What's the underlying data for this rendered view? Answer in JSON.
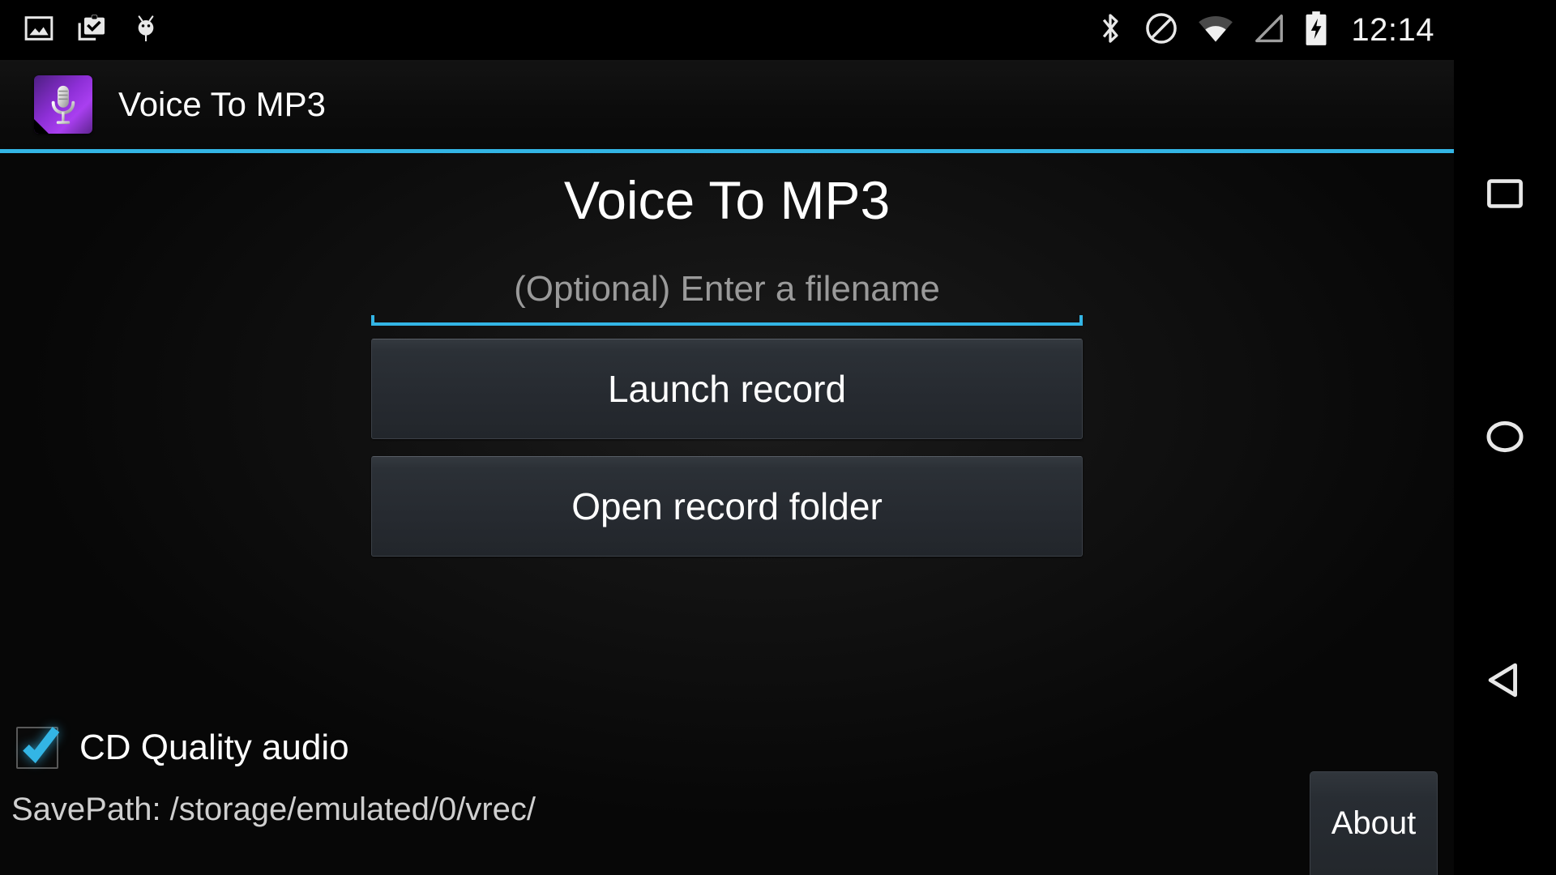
{
  "status_bar": {
    "icons_left": [
      {
        "name": "image-icon",
        "label": "Screenshot"
      },
      {
        "name": "clipboard-check-icon",
        "label": "Clipboard"
      },
      {
        "name": "android-head-icon",
        "label": "Android"
      }
    ],
    "icons_right": [
      {
        "name": "bluetooth-icon",
        "label": "Bluetooth"
      },
      {
        "name": "do-not-disturb-icon",
        "label": "Do not disturb"
      },
      {
        "name": "wifi-icon",
        "label": "Wi-Fi"
      },
      {
        "name": "cellular-signal-icon",
        "label": "No cellular signal"
      },
      {
        "name": "battery-charging-icon",
        "label": "Battery charging"
      }
    ],
    "time": "12:14"
  },
  "action_bar": {
    "app_icon": "microphone-icon",
    "title": "Voice To MP3",
    "accent_color": "#33b5e5"
  },
  "main": {
    "heading": "Voice To MP3",
    "filename": {
      "value": "",
      "placeholder": "(Optional) Enter a filename"
    },
    "buttons": {
      "launch_record": "Launch record",
      "open_record_folder": "Open record folder",
      "about": "About"
    },
    "cd_quality": {
      "label": "CD Quality audio",
      "checked": true
    },
    "save_path": "SavePath: /storage/emulated/0/vrec/"
  },
  "nav_bar": {
    "recents": "Recents",
    "home": "Home",
    "back": "Back"
  },
  "colors": {
    "accent": "#33b5e5",
    "background": "#000000",
    "button_face": "#262a30",
    "text": "#ffffff",
    "muted_text": "#9a9a9a"
  }
}
